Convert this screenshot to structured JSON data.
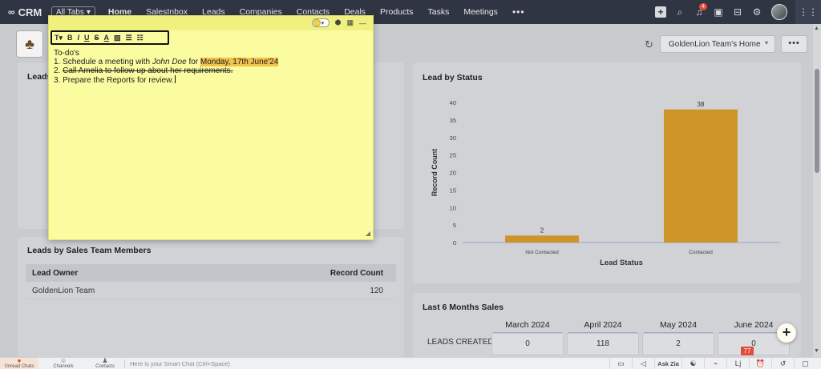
{
  "app": {
    "logo_text": "CRM",
    "logo_icon": "crm-infinity-icon"
  },
  "nav": {
    "alltabs_label": "All Tabs",
    "items": [
      "Home",
      "SalesInbox",
      "Leads",
      "Companies",
      "Contacts",
      "Deals",
      "Products",
      "Tasks",
      "Meetings"
    ],
    "more": "•••",
    "notification_count": "4"
  },
  "home": {
    "selector_value": "GoldenLion Team's Home",
    "more_label": "•••"
  },
  "panels": {
    "leads_title": "Leads",
    "lead_by_status_title": "Lead by Status",
    "sales_team_title": "Leads by Sales Team Members",
    "last6_title": "Last 6 Months Sales"
  },
  "sales_team": {
    "headers": [
      "Lead Owner",
      "Record Count"
    ],
    "rows": [
      {
        "owner": "GoldenLion Team",
        "count": "120"
      }
    ]
  },
  "last6": {
    "headers": [
      "March 2024",
      "April 2024",
      "May 2024",
      "June 2024"
    ],
    "row_label": "LEADS CREATED",
    "values": [
      "0",
      "118",
      "2",
      "0"
    ]
  },
  "chart_data": {
    "type": "bar",
    "categories": [
      "Not Contacted",
      "Contacted"
    ],
    "values": [
      2,
      38
    ],
    "xlabel": "Lead Status",
    "ylabel": "Record Count",
    "ylim": [
      0,
      40
    ],
    "yticks": [
      0,
      5,
      10,
      15,
      20,
      25,
      30,
      35,
      40
    ],
    "bar_color": "#cf9428"
  },
  "note": {
    "title": "To-do's",
    "item1_prefix": "1.  Schedule a meeting with ",
    "item1_name": "John Doe",
    "item1_mid": " for ",
    "item1_date": "Monday, 17th June'24",
    "item2_num": "2.  ",
    "item2_text": "Call Amelia to follow up about her requirements.",
    "item3": "3.  Prepare the Reports for review.",
    "toolbar": [
      "T▾",
      "B",
      "I",
      "U",
      "S",
      "A",
      "▨",
      "☰",
      "☷"
    ],
    "color": "#fbfba0"
  },
  "misc": {
    "fab_label": "+",
    "badge_77": "77"
  },
  "bottom": {
    "unread_label": "Unread Chats",
    "channels_label": "Channels",
    "contacts_label": "Contacts",
    "smartchat_placeholder": "Here is your Smart Chat (Ctrl+Space)",
    "askzia": "Ask Zia"
  }
}
